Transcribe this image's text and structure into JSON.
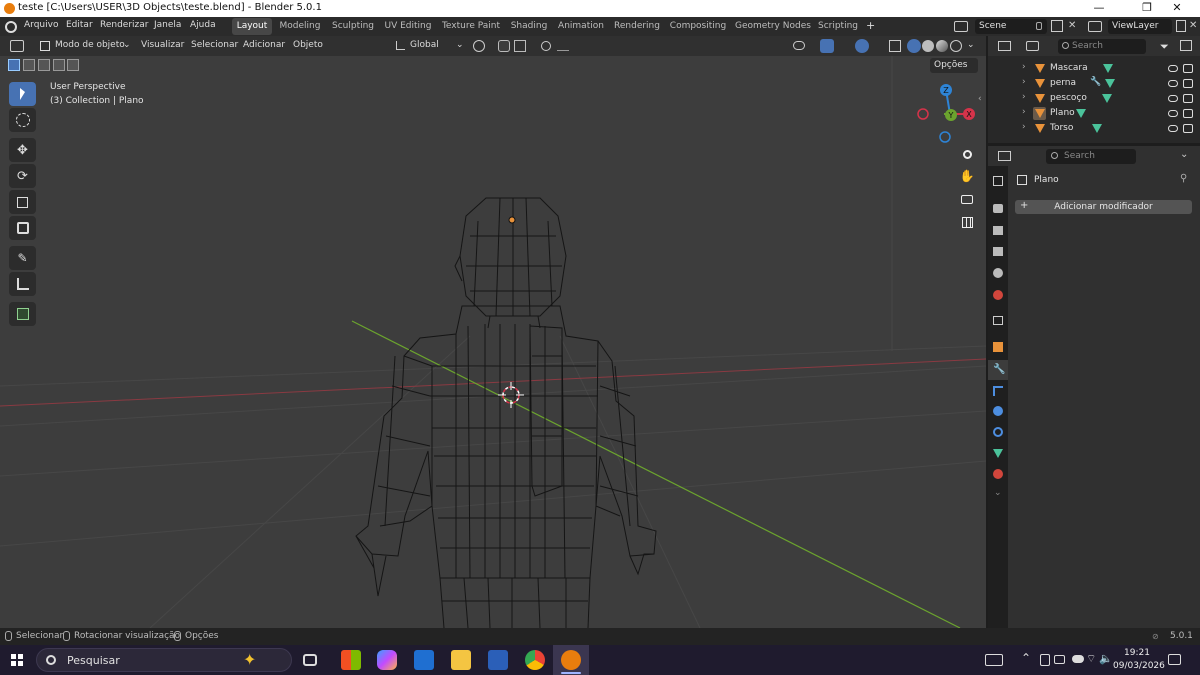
{
  "window": {
    "title": "teste [C:\\Users\\USER\\3D Objects\\teste.blend] - Blender 5.0.1",
    "minimize": "—",
    "maximize": "❐",
    "close": "✕"
  },
  "menu": {
    "items": [
      "Arquivo",
      "Editar",
      "Renderizar",
      "Janela",
      "Ajuda"
    ],
    "workspaces": [
      "Layout",
      "Modeling",
      "Sculpting",
      "UV Editing",
      "Texture Paint",
      "Shading",
      "Animation",
      "Rendering",
      "Compositing",
      "Geometry Nodes",
      "Scripting"
    ],
    "active_workspace": "Layout",
    "add_workspace": "+",
    "scene": "Scene",
    "view_layer": "ViewLayer"
  },
  "viewport": {
    "mode": "Modo de objeto",
    "menus": [
      "Visualizar",
      "Selecionar",
      "Adicionar",
      "Objeto"
    ],
    "transform_orientation": "Global",
    "options_label": "Opções",
    "overlay_line1": "User Perspective",
    "overlay_line2": "(3) Collection | Plano",
    "gizmo_axes": {
      "z": "Z",
      "y": "Y",
      "x": "X"
    }
  },
  "tools": [
    "select-box",
    "cursor",
    "move",
    "rotate",
    "scale",
    "transform",
    "annotate",
    "measure",
    "add-cube"
  ],
  "outliner": {
    "search_placeholder": "Search",
    "rows": [
      {
        "name": "Mascara",
        "selected": false
      },
      {
        "name": "perna",
        "selected": false
      },
      {
        "name": "pescoço",
        "selected": false
      },
      {
        "name": "Plano",
        "selected": false
      },
      {
        "name": "Torso",
        "selected": false
      }
    ]
  },
  "properties": {
    "search_placeholder": "Search",
    "object_name": "Plano",
    "add_modifier": "Adicionar modificador"
  },
  "status": {
    "select": "Selecionar",
    "rotate_view": "Rotacionar visualização",
    "options": "Opções",
    "version": "5.0.1"
  },
  "taskbar": {
    "search_placeholder": "Pesquisar",
    "time": "19:21",
    "date": "09/03/2026"
  },
  "colors": {
    "accent": "#4772b3",
    "x_axis": "#d6334a",
    "y_axis": "#6ba32e",
    "z_axis": "#2e84d6",
    "object_orange": "#e8923a"
  }
}
